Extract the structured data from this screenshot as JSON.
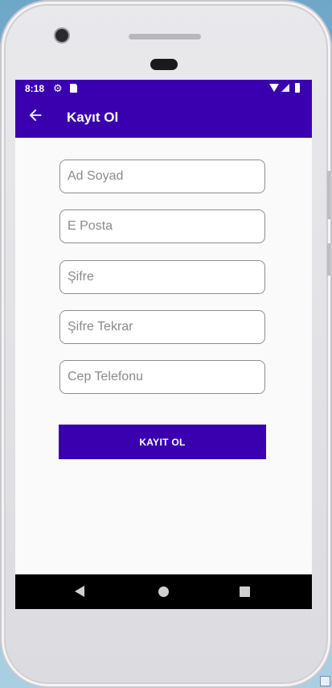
{
  "status_bar": {
    "time": "8:18",
    "icons": [
      "gear-icon",
      "sd-card-icon",
      "wifi-icon",
      "signal-icon",
      "battery-icon"
    ]
  },
  "app_bar": {
    "title": "Kayıt Ol",
    "back_icon": "arrow-left-icon"
  },
  "form": {
    "name_placeholder": "Ad Soyad",
    "email_placeholder": "E Posta",
    "password_placeholder": "Şifre",
    "password_repeat_placeholder": "Şifre Tekrar",
    "phone_placeholder": "Cep Telefonu",
    "submit_label": "KAYIT OL"
  },
  "nav_bar": {
    "icons": [
      "nav-back-icon",
      "nav-home-icon",
      "nav-recents-icon"
    ]
  },
  "colors": {
    "primary": "#3a00b0",
    "screen_bg": "#fafafa",
    "field_border": "#8d8d8d",
    "nav_bg": "#000000"
  }
}
